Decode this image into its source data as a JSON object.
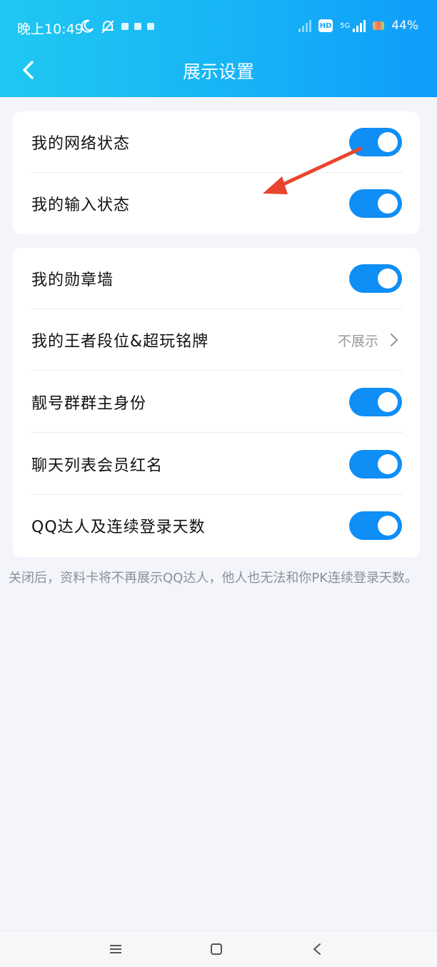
{
  "status_bar": {
    "time": "晚上10:49",
    "hd_label": "HD",
    "network_label": "5G",
    "battery_percent": "44%"
  },
  "header": {
    "title": "展示设置",
    "back_icon": "chevron-left-icon"
  },
  "sections": [
    {
      "items": [
        {
          "label": "我的网络状态",
          "type": "toggle",
          "on": true
        },
        {
          "label": "我的输入状态",
          "type": "toggle",
          "on": true
        }
      ]
    },
    {
      "items": [
        {
          "label": "我的勋章墙",
          "type": "toggle",
          "on": true
        },
        {
          "label": "我的王者段位&超玩铭牌",
          "type": "link",
          "value": "不展示"
        },
        {
          "label": "靓号群群主身份",
          "type": "toggle",
          "on": true
        },
        {
          "label": "聊天列表会员红名",
          "type": "toggle",
          "on": true
        },
        {
          "label": "QQ达人及连续登录天数",
          "type": "toggle",
          "on": true
        }
      ]
    }
  ],
  "footer_note": "关闭后，资料卡将不再展示QQ达人，他人也无法和你PK连续登录天数。",
  "bottom_nav": {
    "icons": [
      "menu-icon",
      "home-square-icon",
      "back-triangle-icon"
    ]
  },
  "colors": {
    "header_start": "#1fc8f2",
    "header_end": "#0f9cfb",
    "toggle_on": "#0f8ef5",
    "background": "#f4f5fa",
    "annotation_arrow": "#e8452f"
  }
}
